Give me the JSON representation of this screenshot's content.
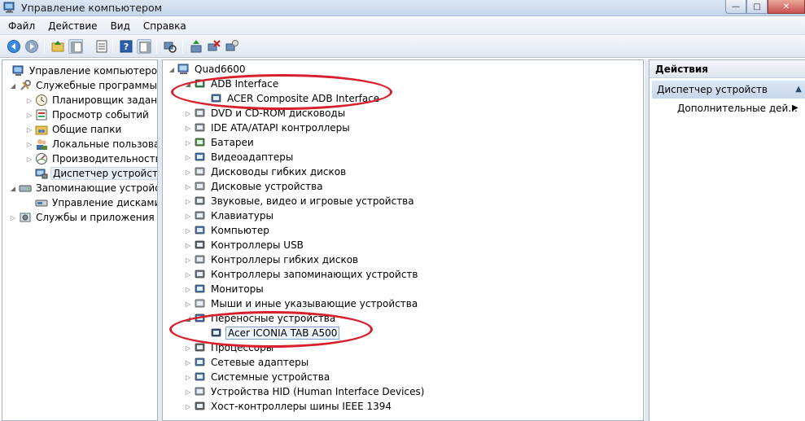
{
  "window": {
    "title": "Управление компьютером"
  },
  "menu": [
    "Файл",
    "Действие",
    "Вид",
    "Справка"
  ],
  "left_tree": {
    "root": "Управление компьютером (л",
    "system_tools": "Служебные программы",
    "task_scheduler": "Планировщик заданий",
    "event_viewer": "Просмотр событий",
    "shared_folders": "Общие папки",
    "local_users": "Локальные пользовате",
    "performance": "Производительность",
    "device_manager": "Диспетчер устройств",
    "storage": "Запоминающие устройст",
    "disk_management": "Управление дисками",
    "services_apps": "Службы и приложения"
  },
  "device_tree": {
    "computer": "Quad6600",
    "categories": [
      "ADB Interface",
      "ACER Composite ADB Interface",
      "DVD и CD-ROM дисководы",
      "IDE ATA/ATAPI контроллеры",
      "Батареи",
      "Видеоадаптеры",
      "Дисководы гибких дисков",
      "Дисковые устройства",
      "Звуковые, видео и игровые устройства",
      "Клавиатуры",
      "Компьютер",
      "Контроллеры USB",
      "Контроллеры гибких дисков",
      "Контроллеры запоминающих устройств",
      "Мониторы",
      "Мыши и иные указывающие устройства",
      "Переносные устройства",
      "Acer ICONIA TAB A500",
      "Процессоры",
      "Сетевые адаптеры",
      "Системные устройства",
      "Устройства HID (Human Interface Devices)",
      "Хост-контроллеры шины IEEE 1394"
    ]
  },
  "actions": {
    "header": "Действия",
    "section": "Диспетчер устройств",
    "more": "Дополнительные дей..."
  },
  "colors": {
    "annotation": "#d8202d",
    "selection": "#e8eef6"
  }
}
